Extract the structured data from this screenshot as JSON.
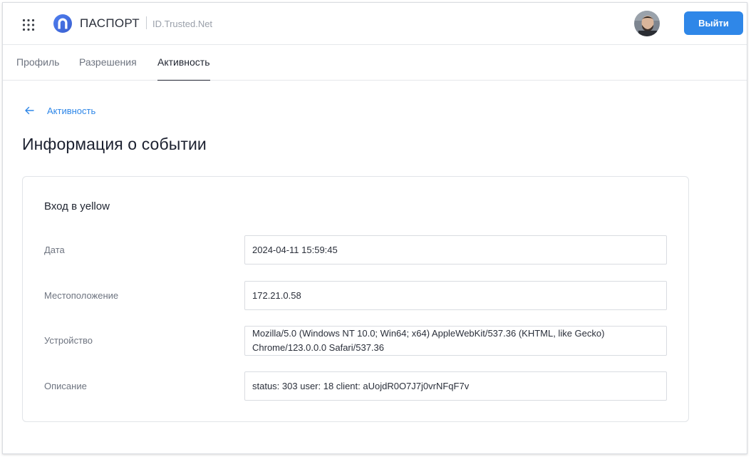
{
  "header": {
    "brand": "ПАСПОРТ",
    "brand_sub": "ID.Trusted.Net",
    "logout_label": "Выйти",
    "accent": "#2f87e8"
  },
  "tabs": [
    {
      "label": "Профиль",
      "active": false
    },
    {
      "label": "Разрешения",
      "active": false
    },
    {
      "label": "Активность",
      "active": true
    }
  ],
  "breadcrumb": {
    "back_label": "Активность",
    "icon": "arrow-left-icon"
  },
  "page_title": "Информация о событии",
  "event": {
    "title": "Вход в yellow",
    "fields": [
      {
        "label": "Дата",
        "value": "2024-04-11 15:59:45"
      },
      {
        "label": "Местоположение",
        "value": "172.21.0.58"
      },
      {
        "label": "Устройство",
        "value": "Mozilla/5.0 (Windows NT 10.0; Win64; x64) AppleWebKit/537.36 (KHTML, like Gecko) Chrome/123.0.0.0 Safari/537.36"
      },
      {
        "label": "Описание",
        "value": "status: 303 user: 18 client: aUojdR0O7J7j0vrNFqF7v"
      }
    ]
  },
  "icons": {
    "apps": "apps-grid-icon",
    "logo": "passport-logo-icon",
    "back": "arrow-left-icon"
  }
}
